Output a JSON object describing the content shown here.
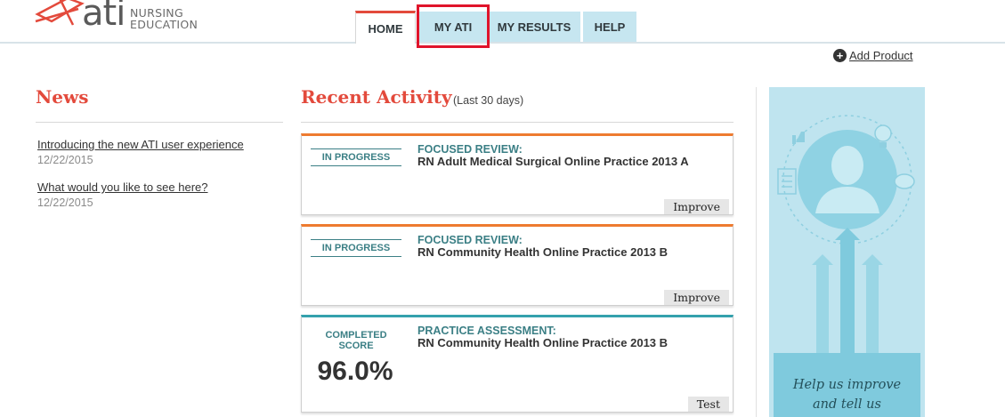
{
  "header": {
    "logo_text": "ati",
    "logo_sub_line1": "NURSING",
    "logo_sub_line2": "EDUCATION"
  },
  "tabs": [
    {
      "label": "HOME",
      "active": true
    },
    {
      "label": "MY ATI",
      "active": false,
      "highlighted": true
    },
    {
      "label": "MY RESULTS",
      "active": false
    },
    {
      "label": "HELP",
      "active": false
    }
  ],
  "add_product": {
    "icon": "plus-circle-icon",
    "label": "Add Product"
  },
  "news": {
    "title": "News",
    "items": [
      {
        "link": "Introducing the new ATI user experience",
        "date": "12/22/2015"
      },
      {
        "link": "What would you like to see here?",
        "date": "12/22/2015"
      }
    ]
  },
  "recent_activity": {
    "title": "Recent Activity",
    "subtitle": "(Last 30 days)",
    "cards": [
      {
        "status": "IN PROGRESS",
        "type": "FOCUSED REVIEW:",
        "name": "RN Adult Medical Surgical Online Practice 2013 A",
        "button": "Improve",
        "accent": "#ee7b30"
      },
      {
        "status": "IN PROGRESS",
        "type": "FOCUSED REVIEW:",
        "name": "RN Community Health Online Practice 2013 B",
        "button": "Improve",
        "accent": "#ee7b30"
      },
      {
        "status_line1": "COMPLETED",
        "status_line2": "SCORE",
        "score": "96.0%",
        "type": "PRACTICE ASSESSMENT:",
        "name": "RN Community Health Online Practice 2013 B",
        "button": "Test",
        "accent": "#34a1ad"
      }
    ]
  },
  "promo": {
    "line1": "Help us improve",
    "line2": "and tell us"
  },
  "colors": {
    "accent_red": "#e34a3c",
    "tab_bg": "#c6e6f0",
    "teal_text": "#3b7f85",
    "highlight_box": "#e0142b"
  }
}
